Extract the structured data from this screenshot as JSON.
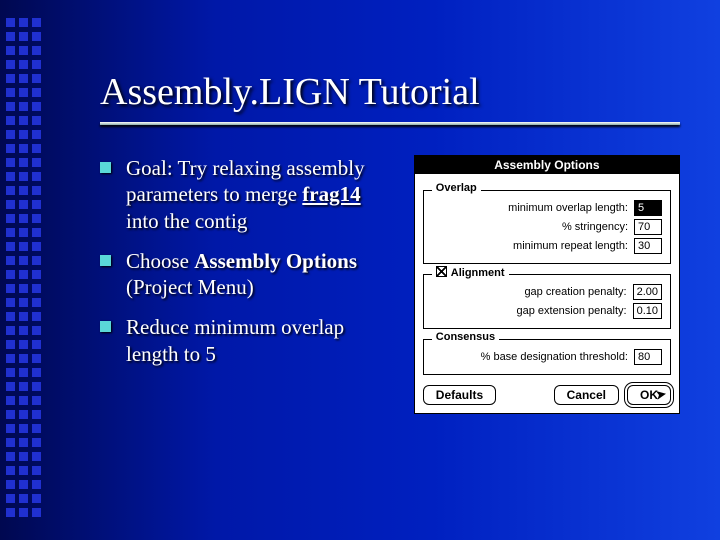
{
  "title": "Assembly.LIGN Tutorial",
  "bullets": [
    {
      "pre": "Goal: Try relaxing assembly parameters to merge ",
      "em": "frag14",
      "post": " into the contig"
    },
    {
      "pre": "Choose ",
      "strong": "Assembly Options",
      "post": " (Project Menu)"
    },
    {
      "pre": "Reduce minimum overlap length to 5",
      "strong": "",
      "post": ""
    }
  ],
  "dialog": {
    "title": "Assembly Options",
    "overlap": {
      "group": "Overlap",
      "min_overlap_label": "minimum overlap length:",
      "min_overlap_value": "5",
      "stringency_label": "% stringency:",
      "stringency_value": "70",
      "min_repeat_label": "minimum repeat length:",
      "min_repeat_value": "30"
    },
    "alignment": {
      "group": "Alignment",
      "gap_create_label": "gap creation penalty:",
      "gap_create_value": "2.00",
      "gap_ext_label": "gap extension penalty:",
      "gap_ext_value": "0.10"
    },
    "consensus": {
      "group": "Consensus",
      "threshold_label": "% base designation threshold:",
      "threshold_value": "80"
    },
    "buttons": {
      "defaults": "Defaults",
      "cancel": "Cancel",
      "ok": "OK"
    }
  }
}
